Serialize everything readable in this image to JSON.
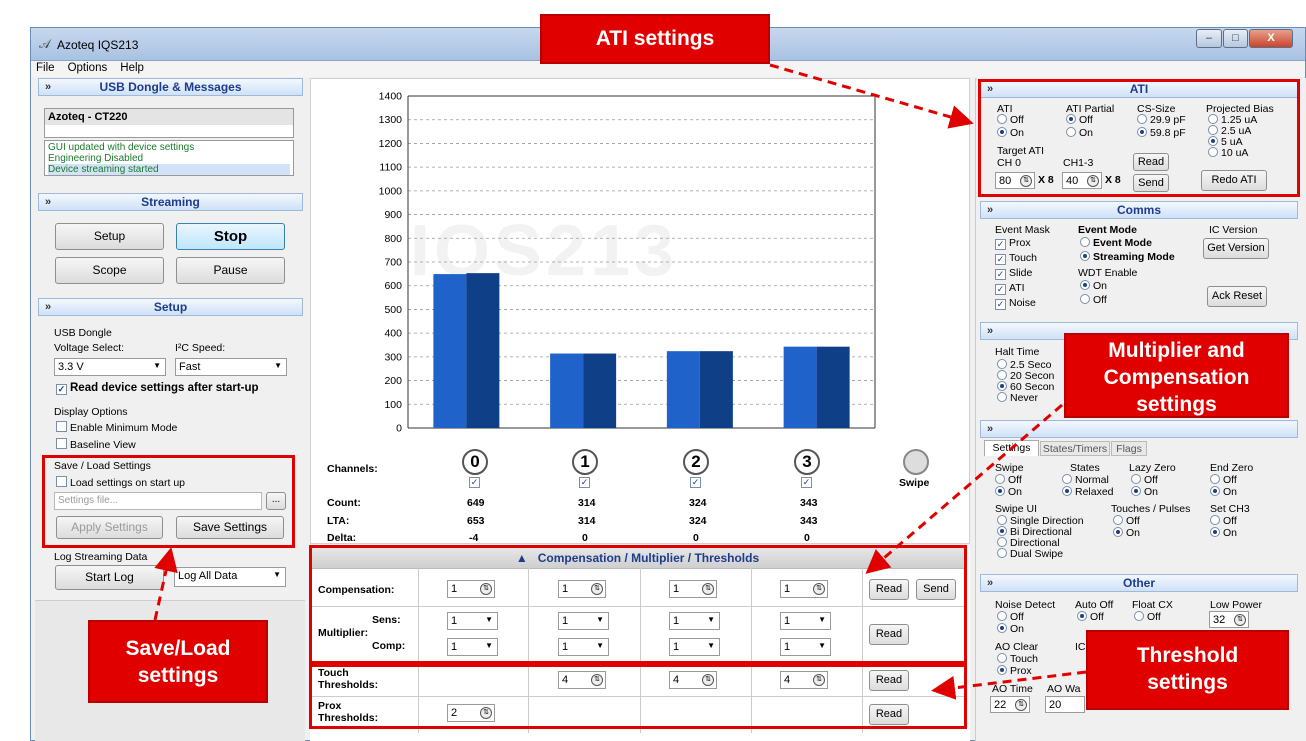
{
  "window": {
    "title": "Azoteq IQS213",
    "min": "–",
    "max": "□",
    "close": "X"
  },
  "menu": [
    "File",
    "Options",
    "Help"
  ],
  "usb_panel": {
    "title": "USB Dongle & Messages",
    "device": "Azoteq - CT220",
    "messages": [
      "GUI updated with device settings",
      "Engineering Disabled",
      "Device streaming started"
    ]
  },
  "streaming": {
    "title": "Streaming",
    "setup": "Setup",
    "stop": "Stop",
    "scope": "Scope",
    "pause": "Pause"
  },
  "setup": {
    "title": "Setup",
    "usb_dongle": "USB Dongle",
    "voltage_label": "Voltage Select:",
    "voltage_value": "3.3 V",
    "i2c_label": "I²C Speed:",
    "i2c_value": "Fast",
    "read_after_startup": "Read device settings after start-up",
    "display_options": "Display Options",
    "min_mode": "Enable Minimum Mode",
    "baseline_view": "Baseline View",
    "save_load": "Save / Load Settings",
    "load_on_start": "Load settings on start up",
    "settings_file_placeholder": "Settings file...",
    "browse": "...",
    "apply": "Apply Settings",
    "save": "Save Settings",
    "log_title": "Log Streaming Data",
    "start_log": "Start Log",
    "log_mode": "Log All Data"
  },
  "chart_data": {
    "type": "bar",
    "watermark": "IQS213",
    "categories": [
      "0",
      "1",
      "2",
      "3"
    ],
    "series": [
      {
        "values": [
          649,
          314,
          324,
          343
        ],
        "color": "#1f62c9"
      },
      {
        "values": [
          653,
          314,
          324,
          343
        ],
        "color": "#0f3f86"
      }
    ],
    "ylim": [
      0,
      1400
    ],
    "yticks": [
      0,
      100,
      200,
      300,
      400,
      500,
      600,
      700,
      800,
      900,
      1000,
      1100,
      1200,
      1300,
      1400
    ],
    "grid": true
  },
  "channels": {
    "label": "Channels:",
    "ids": [
      "0",
      "1",
      "2",
      "3"
    ],
    "swipe": "Swipe",
    "rows": [
      {
        "label": "Count:",
        "values": [
          "649",
          "314",
          "324",
          "343"
        ]
      },
      {
        "label": "LTA:",
        "values": [
          "653",
          "314",
          "324",
          "343"
        ]
      },
      {
        "label": "Delta:",
        "values": [
          "-4",
          "0",
          "0",
          "0"
        ]
      }
    ]
  },
  "cmt": {
    "header": "Compensation / Multiplier / Thresholds",
    "compensation_label": "Compensation:",
    "compensation_values": [
      "1",
      "1",
      "1",
      "1"
    ],
    "multiplier_label": "Multiplier:",
    "sens_label": "Sens:",
    "comp_label": "Comp:",
    "sens_values": [
      "1",
      "1",
      "1",
      "1"
    ],
    "comp_values": [
      "1",
      "1",
      "1",
      "1"
    ],
    "touth_label": "Touch\nThresholds:",
    "touch_values": [
      "4",
      "4",
      "4"
    ],
    "prox_label": "Prox\nThresholds:",
    "prox_value": "2",
    "read": "Read",
    "send": "Send"
  },
  "ati": {
    "title": "ATI",
    "ati": "ATI",
    "off": "Off",
    "on": "On",
    "ati_partial": "ATI Partial",
    "cs_size": "CS-Size",
    "cs1": "29.9 pF",
    "cs2": "59.8 pF",
    "proj_bias": "Projected Bias",
    "pb": [
      "1.25 uA",
      "2.5 uA",
      "5 uA",
      "10 uA"
    ],
    "target_ati": "Target ATI",
    "ch0": "CH 0",
    "ch13": "CH1-3",
    "ch0_val": "80",
    "ch13_val": "40",
    "x8": "X 8",
    "read": "Read",
    "send": "Send",
    "redo": "Redo ATI"
  },
  "comms": {
    "title": "Comms",
    "event_mask": "Event Mask",
    "masks": [
      "Prox",
      "Touch",
      "Slide",
      "ATI",
      "Noise"
    ],
    "event_mode_title": "Event Mode",
    "event_mode": "Event Mode",
    "streaming_mode": "Streaming Mode",
    "wdt": "WDT Enable",
    "on": "On",
    "off": "Off",
    "ic_version": "IC Version",
    "get_version": "Get Version",
    "ack_reset": "Ack Reset"
  },
  "timing": {
    "halt_time": "Halt Time",
    "options": [
      "2.5 Seco",
      "20 Secon",
      "60 Secon",
      "Never"
    ]
  },
  "swipe_tabs": {
    "tabs": [
      "Settings",
      "States/Timers",
      "Flags"
    ],
    "swipe": "Swipe",
    "states": "States",
    "normal": "Normal",
    "relaxed": "Relaxed",
    "lazy_zero": "Lazy Zero",
    "end_zero": "End Zero",
    "swipe_ui": "Swipe UI",
    "single": "Single Direction",
    "bi": "Bi Directional",
    "directional": "Directional",
    "dual": "Dual Swipe",
    "touches": "Touches / Pulses",
    "set_ch3": "Set CH3",
    "off": "Off",
    "on": "On"
  },
  "other": {
    "title": "Other",
    "noise_detect": "Noise Detect",
    "auto_off": "Auto Off",
    "float_cx": "Float CX",
    "low_power": "Low Power",
    "low_power_val": "32",
    "ao_clear": "AO Clear",
    "touch": "Touch",
    "prox": "Prox",
    "ic": "IC",
    "ao_time": "AO Time",
    "ao_wa": "AO Wa",
    "ao_time_val": "22",
    "ao_wa_val": "20",
    "off": "Off",
    "on": "On"
  },
  "annotations": {
    "ati": "ATI settings",
    "mult": "Multiplier and Compensation settings",
    "save": "Save/Load settings",
    "thresh": "Threshold settings"
  }
}
